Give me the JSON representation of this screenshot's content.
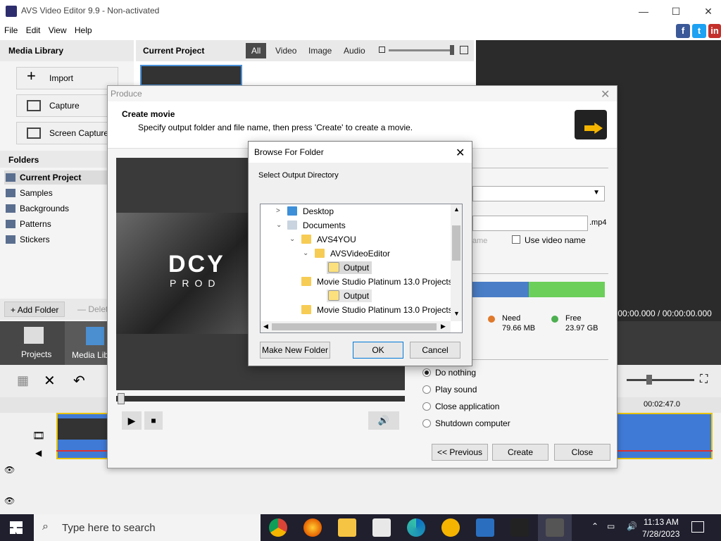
{
  "window": {
    "title": "AVS Video Editor 9.9 - Non-activated"
  },
  "menu": [
    "File",
    "Edit",
    "View",
    "Help"
  ],
  "social": {
    "facebook": "f",
    "twitter": "t",
    "other": "in"
  },
  "left_panel": {
    "media_library_title": "Media Library",
    "buttons": {
      "import": "Import",
      "capture": "Capture",
      "screen_capture": "Screen Capture"
    },
    "folders_title": "Folders",
    "folders": [
      "Current Project",
      "Samples",
      "Backgrounds",
      "Patterns",
      "Stickers"
    ],
    "add_folder": "Add Folder",
    "delete": "Delete"
  },
  "project_panel": {
    "title": "Current Project",
    "filters": [
      "All",
      "Video",
      "Image",
      "Audio"
    ]
  },
  "mode_tabs": {
    "projects": "Projects",
    "media_library": "Media Libra"
  },
  "timeline": {
    "time_right": "00:02:47.0"
  },
  "time_display": ":00:00.000 / 00:00:00.000",
  "produce": {
    "title": "Produce",
    "heading": "Create movie",
    "subtext": "Specify output folder and file name, then press 'Create' to create a movie.",
    "ext": ".mp4",
    "use_video_name": "Use video name",
    "name_hint": "ame",
    "need_label": "Need",
    "need_value": "79.66 MB",
    "free_label": "Free",
    "free_value": "23.97 GB",
    "options": [
      "Do nothing",
      "Play sound",
      "Close application",
      "Shutdown computer"
    ],
    "buttons": {
      "previous": "<< Previous",
      "create": "Create",
      "close": "Close"
    },
    "colors": {
      "need": "#e0792b",
      "free": "#4caf50",
      "bar_blue": "#4a7ec7",
      "bar_green": "#6ccf5a"
    }
  },
  "browse": {
    "title": "Browse For Folder",
    "prompt": "Select Output Directory",
    "tree": [
      {
        "label": "Desktop",
        "level": 0,
        "chevron": ">"
      },
      {
        "label": "Documents",
        "level": 0,
        "chevron": "v"
      },
      {
        "label": "AVS4YOU",
        "level": 1,
        "chevron": "v"
      },
      {
        "label": "AVSVideoEditor",
        "level": 2,
        "chevron": "v"
      },
      {
        "label": "Output",
        "level": 3,
        "chevron": "",
        "selected": true
      },
      {
        "label": "Movie Studio Platinum 13.0 Projects",
        "level": 1,
        "chevron": ""
      },
      {
        "label": "Output",
        "level": 2,
        "chevron": ""
      },
      {
        "label": "Movie Studio Platinum 13.0 Projects",
        "level": 0,
        "chevron": ""
      }
    ],
    "buttons": {
      "new_folder": "Make New Folder",
      "ok": "OK",
      "cancel": "Cancel"
    }
  },
  "taskbar": {
    "search_placeholder": "Type here to search",
    "time": "11:13 AM",
    "date": "7/28/2023"
  }
}
